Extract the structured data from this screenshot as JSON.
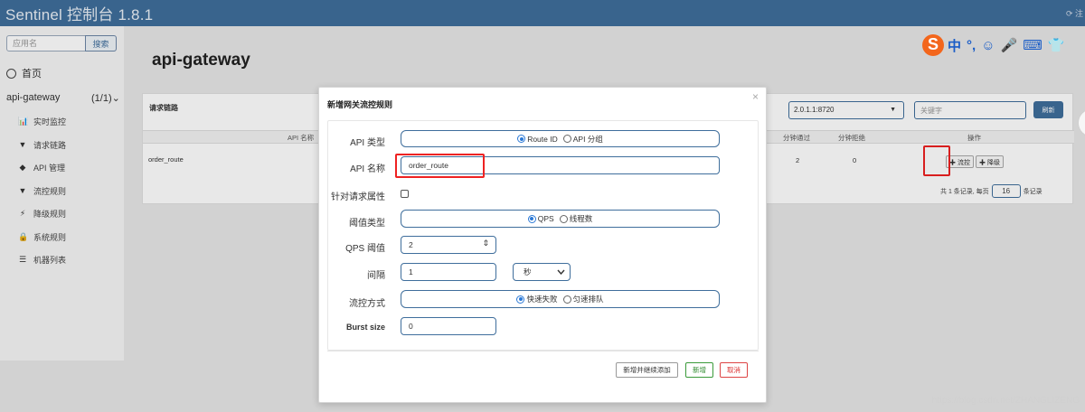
{
  "app": {
    "title": "Sentinel 控制台 1.8.1",
    "logout": "⟳ 注"
  },
  "sidebar": {
    "search_placeholder": "应用名",
    "search_button": "搜索",
    "home": "首页",
    "app_name": "api-gateway",
    "app_count": "(1/1)⌄",
    "items": [
      {
        "icon": "chart-icon",
        "glyph": "📊",
        "label": "实时监控"
      },
      {
        "icon": "filter-icon",
        "glyph": "▼",
        "label": "请求链路"
      },
      {
        "icon": "tag-icon",
        "glyph": "◆",
        "label": "API 管理"
      },
      {
        "icon": "filter-icon",
        "glyph": "▼",
        "label": "流控规则"
      },
      {
        "icon": "bolt-icon",
        "glyph": "⚡",
        "label": "降级规则"
      },
      {
        "icon": "lock-icon",
        "glyph": "🔒",
        "label": "系统规则"
      },
      {
        "icon": "list-icon",
        "glyph": "☰",
        "label": "机器列表"
      }
    ]
  },
  "page": {
    "title": "api-gateway"
  },
  "card": {
    "title": "请求链路",
    "ip_select": "2.0.1.1:8720",
    "keyword_placeholder": "关键字",
    "refresh": "刷新",
    "columns": {
      "api_name": "API 名称",
      "pass_per_min": "分钟通过",
      "block_per_min": "分钟拒绝",
      "actions": "操作"
    },
    "row": {
      "api_name": "order_route",
      "pass": "2",
      "block": "0"
    },
    "flow_button": "✚ 流控",
    "degrade_button": "✚ 降级",
    "pager": {
      "prefix": "共 1 条记录, 每页",
      "page_size": "16",
      "suffix": "条记录"
    }
  },
  "modal": {
    "title": "新增网关流控规则",
    "close": "×",
    "fields": {
      "api_type_label": "API 类型",
      "api_type_options": [
        "Route ID",
        "API 分组"
      ],
      "api_name_label": "API 名称",
      "api_name_value": "order_route",
      "param_attr_label": "针对请求属性",
      "threshold_type_label": "阈值类型",
      "threshold_type_options": [
        "QPS",
        "线程数"
      ],
      "qps_label": "QPS 阈值",
      "qps_value": "2",
      "interval_label": "间隔",
      "interval_value": "1",
      "interval_unit": "秒",
      "control_label": "流控方式",
      "control_options": [
        "快速失败",
        "匀速排队"
      ],
      "burst_label": "Burst size",
      "burst_value": "0"
    },
    "buttons": {
      "add_continue": "新增并继续添加",
      "add": "新增",
      "cancel": "取消"
    }
  },
  "ime": {
    "logo": "S",
    "glyphs": [
      "中",
      "°,",
      "☺",
      "🎤",
      "⌨",
      "👕"
    ]
  },
  "watermark": "https://blog.csdn.net/ZHANGLIZENG",
  "colors": {
    "header": "#3f6e9c",
    "highlight": "#e22222",
    "radio_selected": "#2b79d6",
    "ime": "#f3661c"
  }
}
